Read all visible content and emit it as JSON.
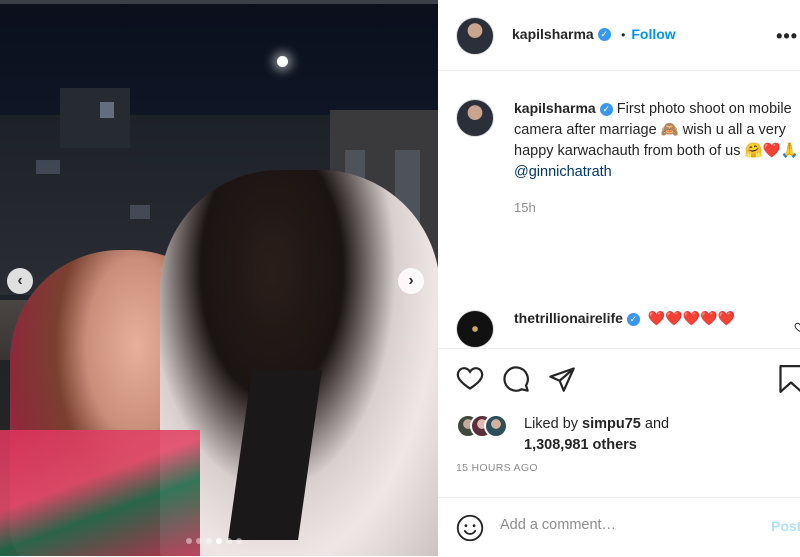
{
  "post": {
    "author": "kapilsharma",
    "follow_label": "Follow",
    "separator": "•",
    "more_label": "•••",
    "verified_glyph": "✓",
    "caption_text": "First photo shoot on mobile camera after marriage 🙈 wish u all a very happy karwachauth from both of us 🤗❤️🙏",
    "caption_mention": "@ginnichatrath",
    "caption_age": "15h",
    "photo_prev": "‹",
    "photo_next": "›",
    "carousel_active_index": 3,
    "carousel_count": 6
  },
  "comment": {
    "author": "thetrillionairelife",
    "text": "❤️❤️❤️❤️❤️"
  },
  "likes": {
    "liked_by_prefix": "Liked by",
    "liked_by_user": "simpu75",
    "and_label": "and",
    "others": "1,308,981 others"
  },
  "timestamp": "15 HOURS AGO",
  "add_comment": {
    "placeholder": "Add a comment…",
    "post_label": "Post"
  },
  "icons": [
    "heart-icon",
    "comment-icon",
    "share-icon",
    "bookmark-icon",
    "emoji-icon",
    "verified-icon"
  ],
  "colors": {
    "link": "#0095f6",
    "mention": "#00376b",
    "verified": "#3897f0",
    "muted": "#8e8e8e",
    "heart": "#ed4956"
  }
}
